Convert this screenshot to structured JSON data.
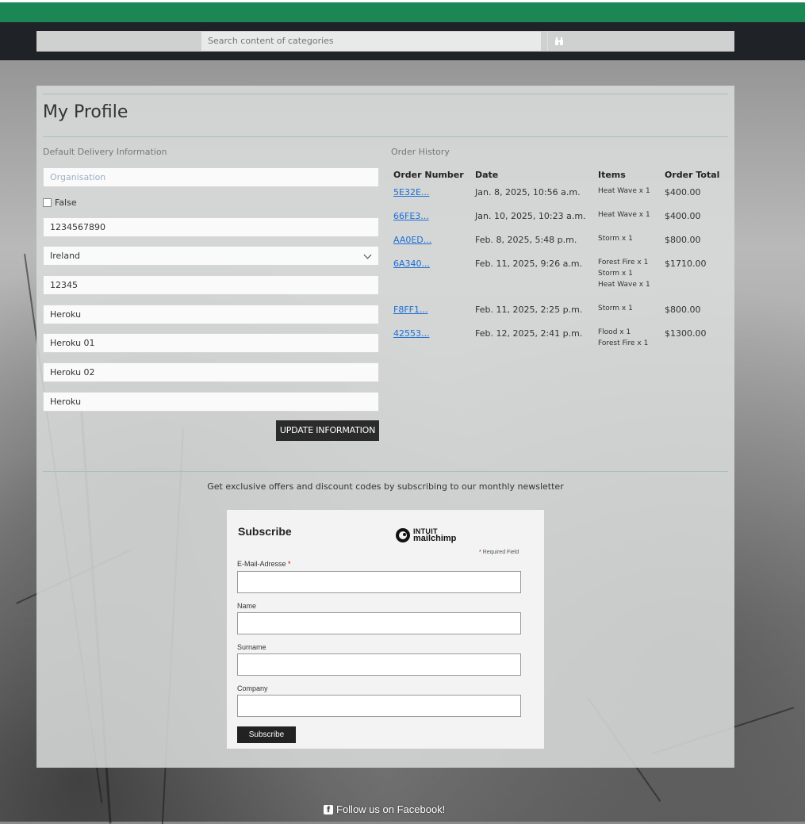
{
  "search": {
    "placeholder": "Search content of categories",
    "icon": "binoculars-icon"
  },
  "profile": {
    "title": "My Profile",
    "delivery_label": "Default Delivery Information",
    "fields": {
      "organisation_placeholder": "Organisation",
      "checkbox_label": "False",
      "phone": "1234567890",
      "country": "Ireland",
      "postcode": "12345",
      "town": "Heroku",
      "street1": "Heroku 01",
      "street2": "Heroku 02",
      "county": "Heroku"
    },
    "update_button": "UPDATE INFORMATION"
  },
  "orders": {
    "label": "Order History",
    "headers": [
      "Order Number",
      "Date",
      "Items",
      "Order Total"
    ],
    "rows": [
      {
        "number": "5E32E...",
        "date": "Jan. 8, 2025, 10:56 a.m.",
        "items": [
          "Heat Wave x 1"
        ],
        "total": "$400.00"
      },
      {
        "number": "66FE3...",
        "date": "Jan. 10, 2025, 10:23 a.m.",
        "items": [
          "Heat Wave x 1"
        ],
        "total": "$400.00"
      },
      {
        "number": "AA0ED...",
        "date": "Feb. 8, 2025, 5:48 p.m.",
        "items": [
          "Storm x 1"
        ],
        "total": "$800.00"
      },
      {
        "number": "6A340...",
        "date": "Feb. 11, 2025, 9:26 a.m.",
        "items": [
          "Forest Fire x 1",
          "Storm x 1",
          "Heat Wave x 1"
        ],
        "total": "$1710.00"
      },
      {
        "number": "F8FF1...",
        "date": "Feb. 11, 2025, 2:25 p.m.",
        "items": [
          "Storm x 1"
        ],
        "total": "$800.00"
      },
      {
        "number": "42553...",
        "date": "Feb. 12, 2025, 2:41 p.m.",
        "items": [
          "Flood x 1",
          "Forest Fire x 1"
        ],
        "total": "$1300.00"
      }
    ]
  },
  "newsletter": {
    "text": "Get exclusive offers and discount codes by subscribing to our monthly newsletter",
    "title": "Subscribe",
    "logo_line1": "INTUIT",
    "logo_line2": "mailchimp",
    "required_note": "Required Field",
    "required_star": "*",
    "email_label": "E-Mail-Adresse",
    "name_label": "Name",
    "surname_label": "Surname",
    "company_label": "Company",
    "button": "Subscribe"
  },
  "footer": {
    "facebook": "Follow us on Facebook!"
  },
  "colors": {
    "brand_green": "#1a8755",
    "navbar": "#1f2226",
    "link": "#1a6fd6"
  }
}
